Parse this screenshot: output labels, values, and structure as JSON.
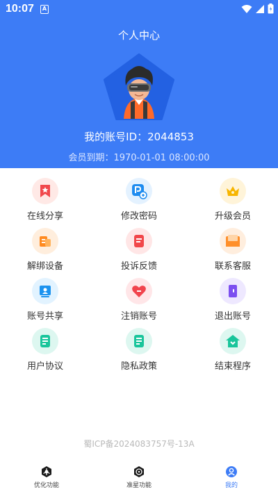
{
  "status_bar": {
    "time": "10:07",
    "notif_letter": "A"
  },
  "header": {
    "title": "个人中心",
    "account_id": "我的账号ID：2044853",
    "member_label": "会员到期：",
    "member_expiry": "1970-01-01 08:00:00",
    "bg_color": "#3d7cf6"
  },
  "menu": [
    {
      "label": "在线分享",
      "icon": "bookmark-star-icon"
    },
    {
      "label": "修改密码",
      "icon": "p-edit-icon"
    },
    {
      "label": "升级会员",
      "icon": "crown-icon"
    },
    {
      "label": "解绑设备",
      "icon": "device-unbind-icon"
    },
    {
      "label": "投诉反馈",
      "icon": "feedback-icon"
    },
    {
      "label": "联系客服",
      "icon": "mail-icon"
    },
    {
      "label": "账号共享",
      "icon": "account-share-icon"
    },
    {
      "label": "注销账号",
      "icon": "heart-remove-icon"
    },
    {
      "label": "退出账号",
      "icon": "logout-door-icon"
    },
    {
      "label": "用户协议",
      "icon": "user-agreement-icon"
    },
    {
      "label": "隐私政策",
      "icon": "privacy-policy-icon"
    },
    {
      "label": "结束程序",
      "icon": "home-exit-icon"
    }
  ],
  "footer": {
    "icp": "蜀ICP备2024083757号-13A"
  },
  "tabs": [
    {
      "label": "优化功能",
      "icon": "optimize-icon"
    },
    {
      "label": "准星功能",
      "icon": "crosshair-icon"
    },
    {
      "label": "我的",
      "icon": "profile-icon",
      "active": true
    }
  ]
}
